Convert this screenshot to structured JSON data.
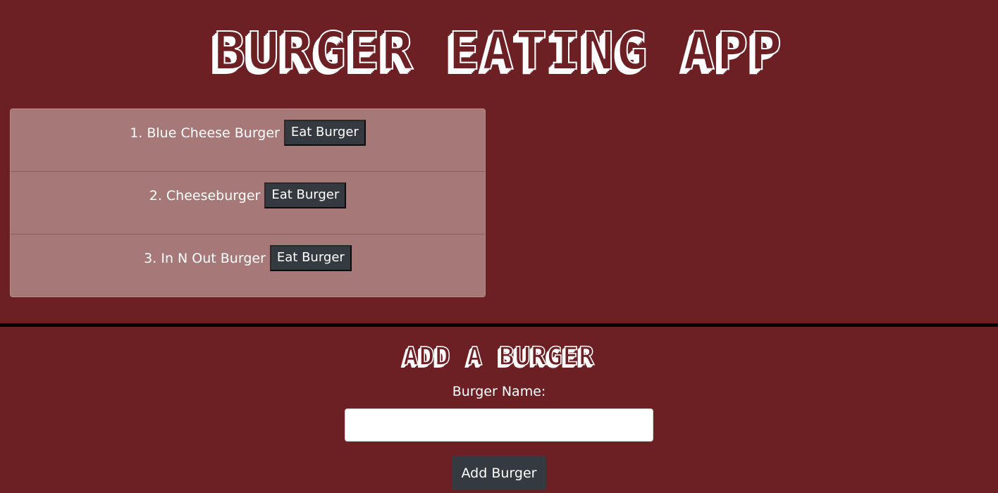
{
  "header": {
    "title": "BURGER EATING APP"
  },
  "burgers": [
    {
      "name": "1. Blue Cheese Burger",
      "button_label": "Eat Burger"
    },
    {
      "name": "2. Cheeseburger",
      "button_label": "Eat Burger"
    },
    {
      "name": "3. In N Out Burger",
      "button_label": "Eat Burger"
    }
  ],
  "add_form": {
    "heading": "ADD A BURGER",
    "label": "Burger Name:",
    "input_value": "",
    "button_label": "Add Burger"
  },
  "colors": {
    "background": "#6d2024",
    "list_background": "#a67878",
    "button": "#343a40",
    "divider": "#000000"
  }
}
